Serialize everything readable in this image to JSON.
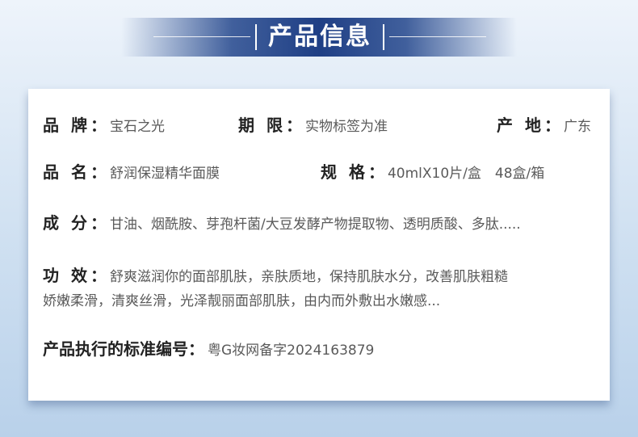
{
  "title": "产品信息",
  "rows": {
    "brand": {
      "label": "品 牌",
      "value": "宝石之光"
    },
    "period": {
      "label": "期 限",
      "value": "实物标签为准"
    },
    "origin": {
      "label": "产 地",
      "value": "广东"
    },
    "name": {
      "label": "品 名",
      "value": "舒润保湿精华面膜"
    },
    "spec": {
      "label": "规 格",
      "value": "40mlX10片/盒　48盒/箱"
    },
    "ingredients": {
      "label": "成 分",
      "value": "甘油、烟酰胺、芽孢杆菌/大豆发酵产物提取物、透明质酸、多肽....."
    },
    "effect": {
      "label": "功 效",
      "line1": "舒爽滋润你的面部肌肤，亲肤质地，保持肌肤水分，改善肌肤粗糙",
      "line2": "娇嫩柔滑，清爽丝滑，光泽靓丽面部肌肤，由内而外敷出水嫩感..."
    },
    "standard": {
      "label": "产品执行的标准编号",
      "value": "粤G妆网备字2024163879"
    }
  },
  "colon": "："
}
